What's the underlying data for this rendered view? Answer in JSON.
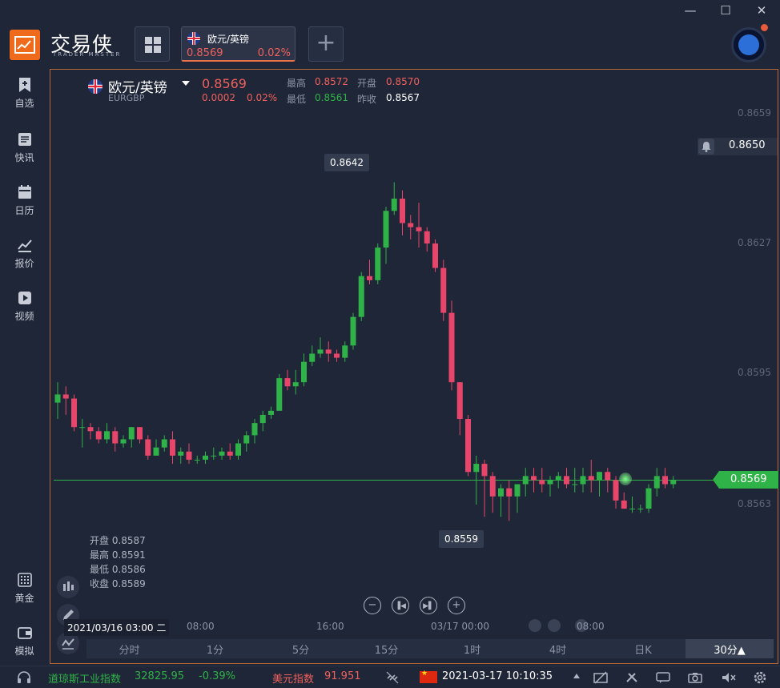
{
  "app": {
    "brand": "交易侠",
    "brand_sub": "TRADER MASTER"
  },
  "tab": {
    "title": "欧元/英镑",
    "price": "0.8569",
    "pct": "0.02%"
  },
  "sidebar": {
    "items": [
      {
        "label": "自选",
        "icon": "bookmark-plus-icon"
      },
      {
        "label": "快讯",
        "icon": "newsfeed-icon"
      },
      {
        "label": "日历",
        "icon": "calendar-icon"
      },
      {
        "label": "报价",
        "icon": "quote-chart-icon"
      },
      {
        "label": "视频",
        "icon": "video-play-icon"
      },
      {
        "label": "黄金",
        "icon": "gold-grid-icon"
      },
      {
        "label": "模拟",
        "icon": "wallet-icon"
      }
    ]
  },
  "header": {
    "name": "欧元/英镑",
    "code": "EURGBP",
    "price": "0.8569",
    "change": "0.0002",
    "pct": "0.02%",
    "high_label": "最高",
    "high": "0.8572",
    "open_label": "开盘",
    "open": "0.8570",
    "low_label": "最低",
    "low": "0.8561",
    "prev_label": "昨收",
    "prev": "0.8567"
  },
  "axis": {
    "prices": [
      "0.8659",
      "0.8627",
      "0.8595",
      "0.8563"
    ],
    "times": [
      "08:00",
      "16:00",
      "03/17 00:00",
      "08:00"
    ],
    "cursor_time": "2021/03/16 03:00 二"
  },
  "alert_price": "0.8650",
  "current_price": "0.8569",
  "tooltips": {
    "high": "0.8642",
    "low": "0.8559"
  },
  "ohlc_box": {
    "open": "开盘 0.8587",
    "high": "最高 0.8591",
    "low": "最低 0.8586",
    "close": "收盘 0.8589"
  },
  "periods": [
    "分时",
    "1分",
    "5分",
    "15分",
    "1时",
    "4时",
    "日K",
    "30分▲"
  ],
  "status": {
    "dow_label": "道琼斯工业指数",
    "dow_value": "32825.95",
    "dow_pct": "-0.39%",
    "usd_label": "美元指数",
    "usd_value": "91.951",
    "datetime": "2021-03-17 10:10:35"
  },
  "colors": {
    "up": "#2fb247",
    "down": "#e8456a",
    "accent": "#f06a1c"
  },
  "chart_data": {
    "type": "candlestick",
    "ylim": [
      0.8555,
      0.8665
    ],
    "candles": [
      [
        0.8588,
        0.8593,
        0.8584,
        0.859
      ],
      [
        0.859,
        0.8592,
        0.8585,
        0.8589
      ],
      [
        0.8589,
        0.859,
        0.8581,
        0.8582
      ],
      [
        0.8582,
        0.8584,
        0.8577,
        0.8582
      ],
      [
        0.8582,
        0.8583,
        0.8579,
        0.8581
      ],
      [
        0.8581,
        0.8582,
        0.8578,
        0.8579
      ],
      [
        0.8579,
        0.8583,
        0.8578,
        0.8581
      ],
      [
        0.8581,
        0.8582,
        0.8576,
        0.8578
      ],
      [
        0.8578,
        0.858,
        0.8577,
        0.8579
      ],
      [
        0.8579,
        0.8582,
        0.8577,
        0.8582
      ],
      [
        0.8582,
        0.8582,
        0.8578,
        0.8579
      ],
      [
        0.8579,
        0.858,
        0.8574,
        0.8575
      ],
      [
        0.8575,
        0.8579,
        0.8575,
        0.8577
      ],
      [
        0.8577,
        0.858,
        0.8576,
        0.8579
      ],
      [
        0.8579,
        0.8581,
        0.8573,
        0.8575
      ],
      [
        0.8575,
        0.8577,
        0.8573,
        0.8576
      ],
      [
        0.8576,
        0.8578,
        0.8573,
        0.8574
      ],
      [
        0.8574,
        0.8575,
        0.8573,
        0.8574
      ],
      [
        0.8574,
        0.8576,
        0.8573,
        0.8575
      ],
      [
        0.8575,
        0.8577,
        0.8574,
        0.8575
      ],
      [
        0.8575,
        0.8577,
        0.8574,
        0.8576
      ],
      [
        0.8576,
        0.8578,
        0.8574,
        0.8575
      ],
      [
        0.8575,
        0.8579,
        0.8574,
        0.8578
      ],
      [
        0.8578,
        0.8581,
        0.8576,
        0.858
      ],
      [
        0.858,
        0.8584,
        0.8578,
        0.8583
      ],
      [
        0.8583,
        0.8586,
        0.8581,
        0.8585
      ],
      [
        0.8585,
        0.8587,
        0.8584,
        0.8586
      ],
      [
        0.8586,
        0.8595,
        0.8586,
        0.8594
      ],
      [
        0.8594,
        0.8596,
        0.8591,
        0.8592
      ],
      [
        0.8592,
        0.8596,
        0.859,
        0.8593
      ],
      [
        0.8593,
        0.86,
        0.8592,
        0.8598
      ],
      [
        0.8598,
        0.8602,
        0.8597,
        0.86
      ],
      [
        0.86,
        0.8604,
        0.8599,
        0.8601
      ],
      [
        0.8601,
        0.8603,
        0.8598,
        0.86
      ],
      [
        0.86,
        0.8601,
        0.8598,
        0.8599
      ],
      [
        0.8599,
        0.8603,
        0.8598,
        0.8602
      ],
      [
        0.8602,
        0.861,
        0.8601,
        0.8609
      ],
      [
        0.8609,
        0.862,
        0.8608,
        0.8619
      ],
      [
        0.8619,
        0.8623,
        0.8617,
        0.8618
      ],
      [
        0.8618,
        0.8627,
        0.8617,
        0.8626
      ],
      [
        0.8626,
        0.8636,
        0.8622,
        0.8635
      ],
      [
        0.8635,
        0.8642,
        0.8634,
        0.8638
      ],
      [
        0.8638,
        0.864,
        0.8629,
        0.8632
      ],
      [
        0.8632,
        0.8634,
        0.8628,
        0.8631
      ],
      [
        0.8631,
        0.8637,
        0.8626,
        0.863
      ],
      [
        0.863,
        0.8631,
        0.8625,
        0.8627
      ],
      [
        0.8627,
        0.8628,
        0.862,
        0.8621
      ],
      [
        0.8621,
        0.8623,
        0.8608,
        0.861
      ],
      [
        0.861,
        0.8613,
        0.8591,
        0.8593
      ],
      [
        0.8593,
        0.8593,
        0.858,
        0.8584
      ],
      [
        0.8584,
        0.8585,
        0.857,
        0.8571
      ],
      [
        0.8571,
        0.8575,
        0.8563,
        0.8573
      ],
      [
        0.8573,
        0.8574,
        0.856,
        0.857
      ],
      [
        0.857,
        0.8571,
        0.8561,
        0.8565
      ],
      [
        0.8565,
        0.8568,
        0.856,
        0.8567
      ],
      [
        0.8567,
        0.8569,
        0.8559,
        0.8565
      ],
      [
        0.8565,
        0.8568,
        0.8561,
        0.8568
      ],
      [
        0.8568,
        0.8572,
        0.8565,
        0.857
      ],
      [
        0.857,
        0.8572,
        0.8566,
        0.8569
      ],
      [
        0.8569,
        0.8572,
        0.8566,
        0.8568
      ],
      [
        0.8568,
        0.857,
        0.8565,
        0.8569
      ],
      [
        0.8569,
        0.8571,
        0.8567,
        0.857
      ],
      [
        0.857,
        0.8572,
        0.8567,
        0.8568
      ],
      [
        0.8568,
        0.8572,
        0.8566,
        0.8568
      ],
      [
        0.8568,
        0.8572,
        0.8566,
        0.857
      ],
      [
        0.857,
        0.8574,
        0.8566,
        0.8569
      ],
      [
        0.8569,
        0.8571,
        0.8565,
        0.8571
      ],
      [
        0.8571,
        0.8572,
        0.8566,
        0.8569
      ],
      [
        0.8569,
        0.857,
        0.8562,
        0.8564
      ],
      [
        0.8564,
        0.8566,
        0.8562,
        0.8562
      ],
      [
        0.8562,
        0.8565,
        0.8561,
        0.8562
      ],
      [
        0.8562,
        0.8563,
        0.8561,
        0.8562
      ],
      [
        0.8562,
        0.8568,
        0.8561,
        0.8567
      ],
      [
        0.8567,
        0.8572,
        0.8565,
        0.857
      ],
      [
        0.857,
        0.8572,
        0.8567,
        0.8568
      ],
      [
        0.8568,
        0.857,
        0.8567,
        0.8569
      ]
    ]
  }
}
